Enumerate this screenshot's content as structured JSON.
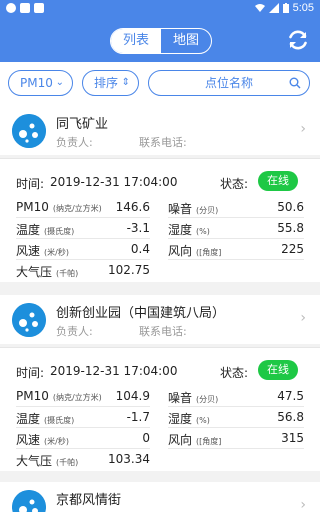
{
  "statusbar": {
    "time": "5:05"
  },
  "header": {
    "tabs": [
      {
        "label": "列表",
        "active": true
      },
      {
        "label": "地图",
        "active": false
      }
    ]
  },
  "filters": {
    "pollutant": "PM10",
    "sort": "排序",
    "search_placeholder": "点位名称"
  },
  "labels": {
    "responsible": "负责人:",
    "phone": "联系电话:",
    "time": "时间:",
    "status": "状态:",
    "pm10": "PM10",
    "pm10_unit": "(纳克/立方米)",
    "noise": "噪音",
    "noise_unit": "(分贝)",
    "temp": "温度",
    "temp_unit": "(摄氏度)",
    "humidity": "湿度",
    "humidity_unit": "(%)",
    "wind_speed": "风速",
    "wind_speed_unit": "(米/秒)",
    "wind_dir": "风向",
    "wind_dir_unit": "([角度]",
    "pressure": "大气压",
    "pressure_unit": "(千帕)"
  },
  "sites": [
    {
      "name": "同飞矿业",
      "time": "2019-12-31 17:04:00",
      "status": "在线",
      "pm10": "146.6",
      "noise": "50.6",
      "temp": "-3.1",
      "humidity": "55.8",
      "wind_speed": "0.4",
      "wind_dir": "225",
      "pressure": "102.75"
    },
    {
      "name": "创新创业园（中国建筑八局）",
      "time": "2019-12-31 17:04:00",
      "status": "在线",
      "pm10": "104.9",
      "noise": "47.5",
      "temp": "-1.7",
      "humidity": "56.8",
      "wind_speed": "0",
      "wind_dir": "315",
      "pressure": "103.34"
    },
    {
      "name": "京都风情街"
    }
  ],
  "colors": {
    "primary": "#4a86e8",
    "online": "#1ec845",
    "logo": "#1d8fdc"
  }
}
